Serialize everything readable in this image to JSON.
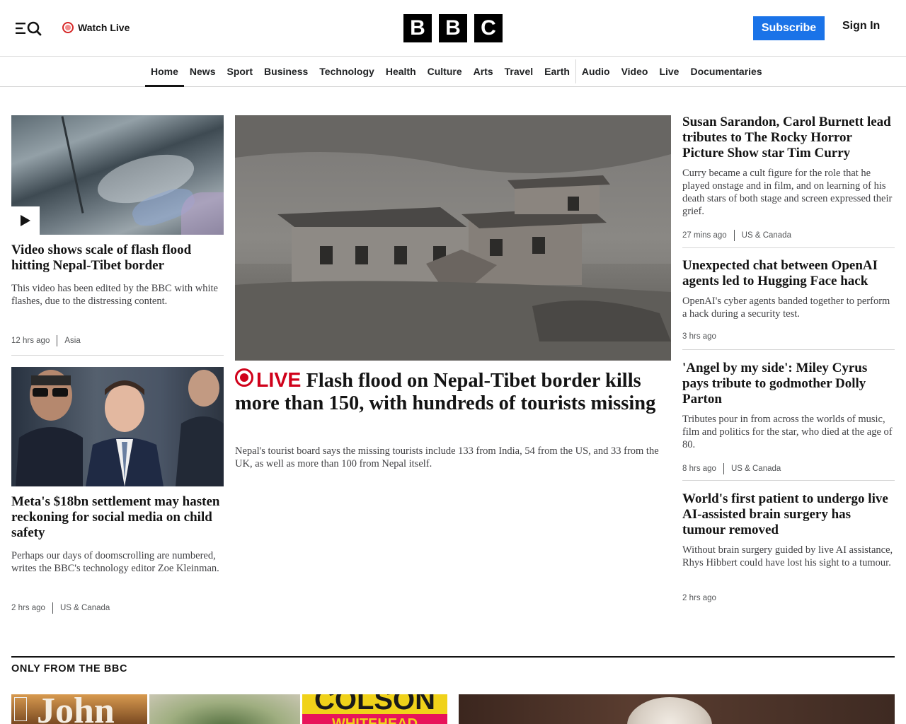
{
  "header": {
    "watch_live": "Watch Live",
    "logo_letters": [
      "B",
      "B",
      "C"
    ],
    "subscribe": "Subscribe",
    "sign_in": "Sign In"
  },
  "nav": {
    "items": [
      "Home",
      "News",
      "Sport",
      "Business",
      "Technology",
      "Health",
      "Culture",
      "Arts",
      "Travel",
      "Earth",
      "Audio",
      "Video",
      "Live",
      "Documentaries"
    ],
    "active": "Home"
  },
  "left": {
    "story1": {
      "title": "Video shows scale of flash flood hitting Nepal-Tibet border",
      "desc": "This video has been edited by the BBC with white flashes, due to the distressing content.",
      "time": "12 hrs ago",
      "region": "Asia"
    },
    "story2": {
      "title": "Meta's $18bn settlement may hasten reckoning for social media on child safety",
      "desc": "Perhaps our days of doomscrolling are numbered, writes the BBC's technology editor Zoe Kleinman.",
      "time": "2 hrs ago",
      "region": "US & Canada"
    }
  },
  "center": {
    "live_label": "LIVE",
    "title": "Flash flood on Nepal-Tibet border kills more than 150, with hundreds of tourists missing",
    "desc": "Nepal's tourist board says the missing tourists include 133 from India, 54 from the US, and 33 from the UK, as well as more than 100 from Nepal itself."
  },
  "right": {
    "story1": {
      "title": "Susan Sarandon, Carol Burnett lead tributes to The Rocky Horror Picture Show star Tim Curry",
      "desc": "Curry became a cult figure for the role that he played onstage and in film, and on learning of his death stars of both stage and screen expressed their grief.",
      "time": "27 mins ago",
      "region": "US & Canada"
    },
    "story2": {
      "title": "Unexpected chat between OpenAI agents led to Hugging Face hack",
      "desc": "OpenAI's cyber agents banded together to perform a hack during a security test.",
      "time": "3 hrs ago"
    },
    "story3": {
      "title": "'Angel by my side': Miley Cyrus pays tribute to godmother Dolly Parton",
      "desc": "Tributes pour in from across the worlds of music, film and politics for the star, who died at the age of 80.",
      "time": "8 hrs ago",
      "region": "US & Canada"
    },
    "story4": {
      "title": "World's first patient to undergo live AI-assisted brain surgery has tumour removed",
      "desc": "Without brain surgery guided by live AI assistance, Rhys Hibbert could have lost his sight to a tumour.",
      "time": "2 hrs ago"
    }
  },
  "bottom": {
    "section_title": "ONLY FROM THE BBC",
    "promo_book1": "John",
    "promo_book3": "COLSON",
    "promo_book3_sub": "WHITEHEAD"
  },
  "colors": {
    "accent_blue": "#1a73e8",
    "live_red": "#d0021b",
    "text": "#141414"
  },
  "icons": [
    "menu-search-icon",
    "live-dot-icon",
    "play-icon",
    "live-ring-icon"
  ]
}
